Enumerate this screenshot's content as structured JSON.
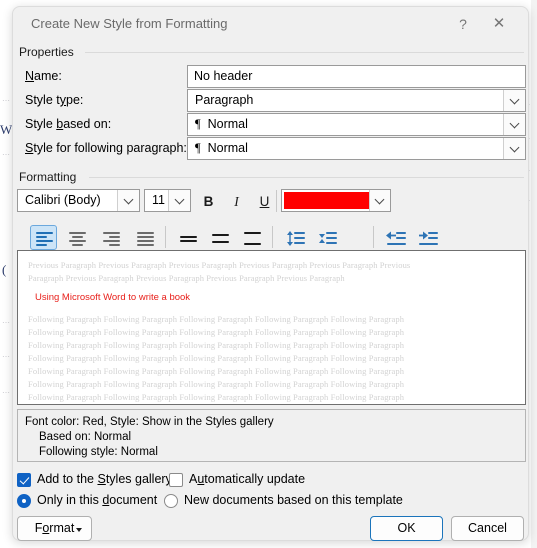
{
  "dialog": {
    "title": "Create New Style from Formatting",
    "help_icon": "?",
    "close_icon": "✕"
  },
  "properties": {
    "group_label": "Properties",
    "name_label": "Name:",
    "name_value": "No header",
    "name_placeholder": "",
    "style_type_label": "Style type:",
    "style_type_value": "Paragraph",
    "style_based_on_label": "Style based on:",
    "style_based_on_value": "Normal",
    "style_based_on_prefix": "¶",
    "style_following_label": "Style for following paragraph:",
    "style_following_value": "Normal",
    "style_following_prefix": "¶"
  },
  "formatting": {
    "group_label": "Formatting",
    "font_family": "Calibri (Body)",
    "font_size": "11",
    "bold_label": "B",
    "italic_label": "I",
    "underline_label": "U",
    "font_color": "#FF0000",
    "font_color_name": "Red",
    "align_left": "align-left",
    "align_center": "align-center",
    "align_right": "align-right",
    "align_justify": "align-justify",
    "selected_alignment": "align-left",
    "line_spacing_single": "line-spacing-single",
    "line_spacing_1_5": "line-spacing-1.5",
    "line_spacing_double": "line-spacing-double",
    "spacing_increase": "increase-paragraph-spacing",
    "spacing_decrease": "decrease-paragraph-spacing",
    "indent_decrease": "decrease-indent",
    "indent_increase": "increase-indent"
  },
  "preview": {
    "previous_line_1": "Previous Paragraph Previous Paragraph Previous Paragraph Previous Paragraph Previous Paragraph Previous",
    "previous_line_2": "Paragraph Previous Paragraph Previous Paragraph Previous Paragraph Previous Paragraph",
    "sample_text": "Using Microsoft Word to write a book",
    "following_line": "Following Paragraph Following Paragraph Following Paragraph Following Paragraph Following Paragraph"
  },
  "description": {
    "line1": "Font color: Red, Style: Show in the Styles gallery",
    "line2": "Based on: Normal",
    "line3": "Following style: Normal"
  },
  "options": {
    "add_to_gallery_label": "Add to the Styles gallery",
    "add_to_gallery_checked": true,
    "auto_update_label": "Automatically update",
    "auto_update_checked": false,
    "only_this_document_label": "Only in this document",
    "only_this_document_selected": true,
    "new_documents_label": "New documents based on this template",
    "new_documents_selected": false
  },
  "buttons": {
    "format_label": "Format",
    "ok_label": "OK",
    "cancel_label": "Cancel"
  }
}
